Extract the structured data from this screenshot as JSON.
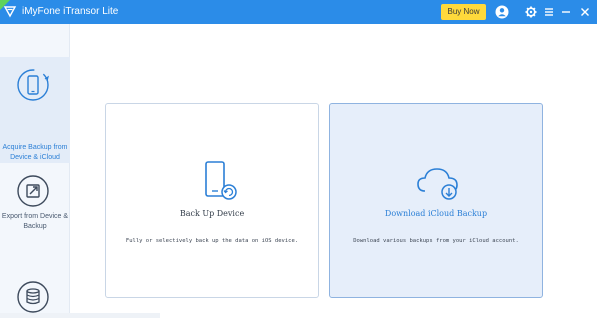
{
  "window": {
    "title": "iMyFone iTransor Lite",
    "buy_button": "Buy Now",
    "icons": [
      "logo-icon",
      "user-icon",
      "gear-icon",
      "menu-icon",
      "minimize-icon",
      "close-icon"
    ]
  },
  "sidebar": {
    "items": [
      {
        "label": "Acquire Backup from Device & iCloud",
        "icon": "phone-restore-icon",
        "active": true
      },
      {
        "label": "Export from Device & Backup",
        "icon": "export-icon",
        "active": false
      },
      {
        "label": "",
        "icon": "database-icon",
        "active": false
      }
    ]
  },
  "main": {
    "cards": [
      {
        "title": "Back Up Device",
        "description": "Fully or selectively back up the data on iOS device.",
        "icon": "phone-backup-icon",
        "selected": false
      },
      {
        "title": "Download iCloud Backup",
        "description": "Download various backups from your iCloud account.",
        "icon": "cloud-download-icon",
        "selected": true
      }
    ]
  },
  "colors": {
    "titlebar": "#2b8ce8",
    "buy_button": "#ffd93b",
    "accent": "#2b7fd6",
    "sidebar_bg": "#f3f7fc",
    "selected_card_bg": "#e6eefa"
  }
}
